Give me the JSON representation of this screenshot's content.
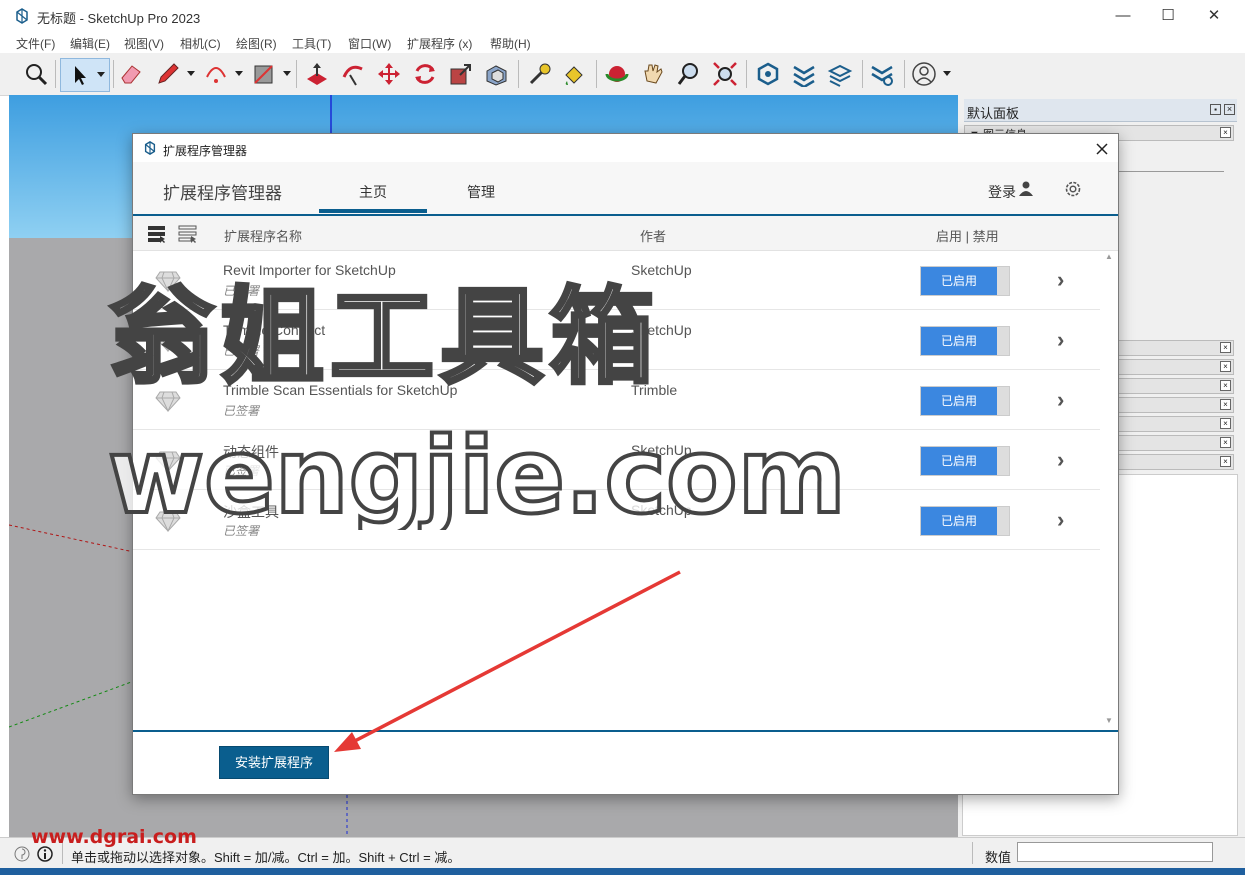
{
  "window": {
    "title": "无标题 - SketchUp Pro 2023",
    "minimize": "—",
    "maximize": "☐",
    "close": "✕"
  },
  "menu": [
    "文件(F)",
    "编辑(E)",
    "视图(V)",
    "相机(C)",
    "绘图(R)",
    "工具(T)",
    "窗口(W)",
    "扩展程序 (x)",
    "帮助(H)"
  ],
  "tray": {
    "title": "默认面板",
    "panel_title": "图元信息"
  },
  "dialog": {
    "title": "扩展程序管理器",
    "heading": "扩展程序管理器",
    "tabs": [
      "主页",
      "管理"
    ],
    "active_tab": "主页",
    "login": "登录",
    "columns": {
      "name": "扩展程序名称",
      "author": "作者",
      "enable": "启用 | 禁用"
    },
    "extensions": [
      {
        "name": "Revit Importer for SketchUp",
        "signed": "已签署",
        "author": "SketchUp",
        "status": "已启用"
      },
      {
        "name": "Trimble Connect",
        "signed": "已签署",
        "author": "SketchUp",
        "status": "已启用"
      },
      {
        "name": "Trimble Scan Essentials for SketchUp",
        "signed": "已签署",
        "author": "Trimble",
        "status": "已启用"
      },
      {
        "name": "动态组件",
        "signed": "已签署",
        "author": "SketchUp",
        "status": "已启用"
      },
      {
        "name": "沙盒工具",
        "signed": "已签署",
        "author": "SketchUp",
        "status": "已启用"
      }
    ],
    "install_button": "安装扩展程序"
  },
  "statusbar": {
    "hint": "单击或拖动以选择对象。Shift = 加/减。Ctrl = 加。Shift + Ctrl = 减。",
    "value_label": "数值",
    "value": ""
  },
  "watermarks": {
    "main_line1": "翁姐工具箱",
    "main_line2": "wengjie.com",
    "corner": "www.dgrai.com"
  },
  "colors": {
    "accent": "#0a5e8e",
    "enabled": "#3b87e0",
    "sky": "#3e9ee0",
    "ground": "#a9a9ab",
    "arrow": "#e53935"
  }
}
